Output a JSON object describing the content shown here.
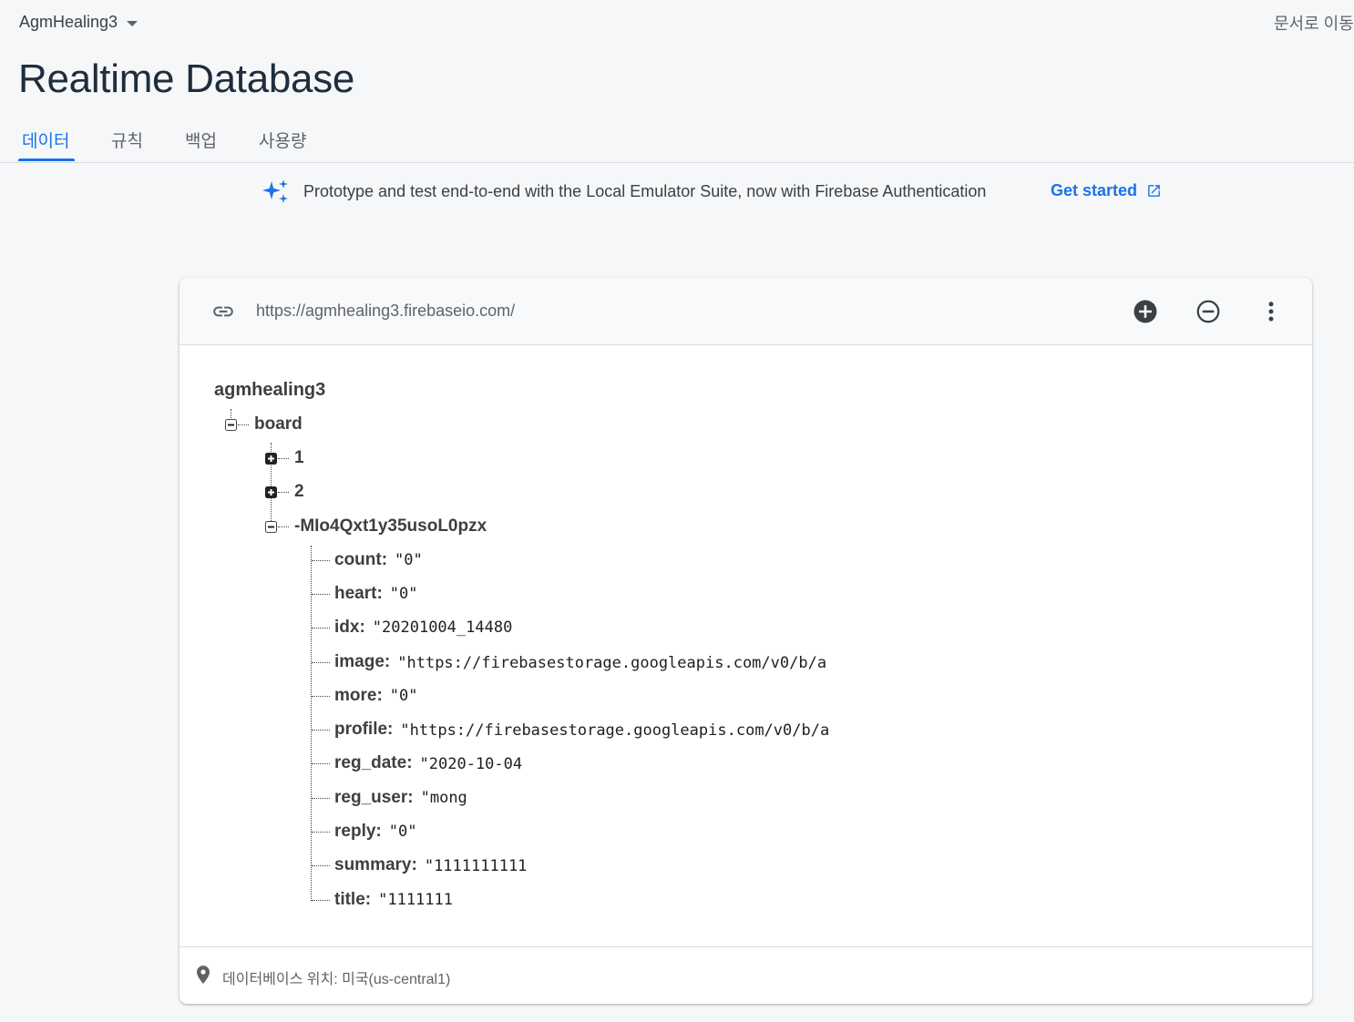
{
  "header": {
    "project_name": "AgmHealing3",
    "docs_link": "문서로 이동",
    "page_title": "Realtime Database"
  },
  "tabs": [
    {
      "label": "데이터",
      "active": true
    },
    {
      "label": "규칙",
      "active": false
    },
    {
      "label": "백업",
      "active": false
    },
    {
      "label": "사용량",
      "active": false
    }
  ],
  "banner": {
    "text": "Prototype and test end-to-end with the Local Emulator Suite, now with Firebase Authentication",
    "cta": "Get started",
    "icon": "sparkle-icon",
    "cta_icon": "open-in-new-icon"
  },
  "database": {
    "url": "https://agmhealing3.firebaseio.com/",
    "actions": [
      "add-circle-icon",
      "remove-circle-icon",
      "more-vert-icon"
    ],
    "root": "agmhealing3",
    "board_key": "board",
    "children": [
      "1",
      "2"
    ],
    "record_key": "-MIo4Qxt1y35usoL0pzx",
    "fields": [
      {
        "key": "count:",
        "value": "\"0\""
      },
      {
        "key": "heart:",
        "value": "\"0\""
      },
      {
        "key": "idx:",
        "value": "\"20201004_14480"
      },
      {
        "key": "image:",
        "value": "\"https://firebasestorage.googleapis.com/v0/b/a"
      },
      {
        "key": "more:",
        "value": "\"0\""
      },
      {
        "key": "profile:",
        "value": "\"https://firebasestorage.googleapis.com/v0/b/a"
      },
      {
        "key": "reg_date:",
        "value": "\"2020-10-04"
      },
      {
        "key": "reg_user:",
        "value": "\"mong"
      },
      {
        "key": "reply:",
        "value": "\"0\""
      },
      {
        "key": "summary:",
        "value": "\"1111111111"
      },
      {
        "key": "title:",
        "value": "\"1111111"
      }
    ],
    "location": "데이터베이스 위치: 미국(us-central1)"
  },
  "colors": {
    "accent": "#1a73e8",
    "background": "#f6f7f9",
    "title": "#1f2d3d"
  }
}
